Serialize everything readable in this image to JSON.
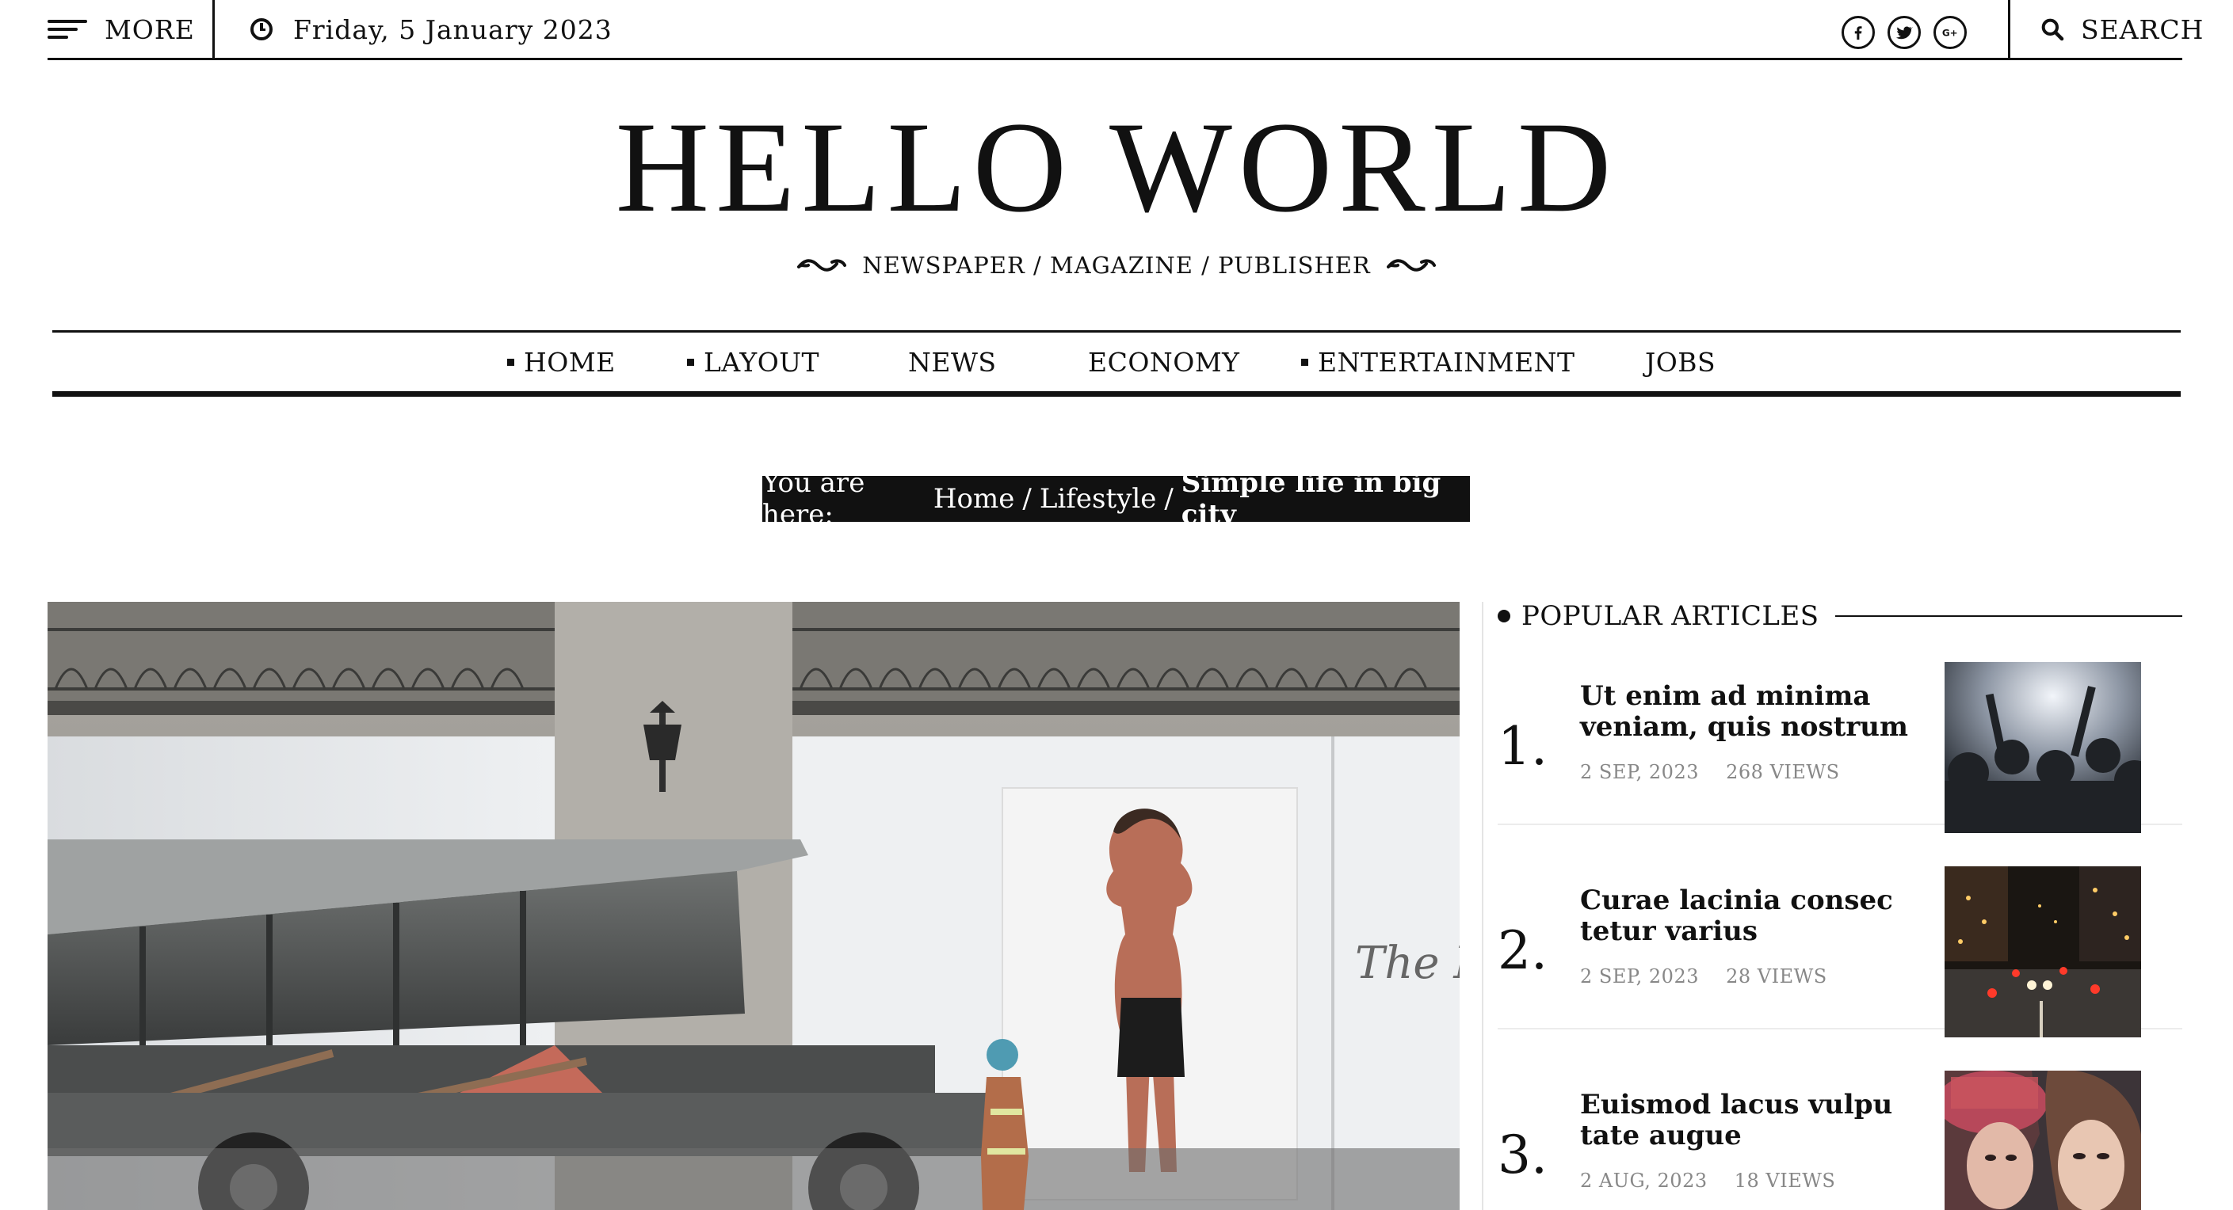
{
  "topbar": {
    "more_label": "MORE",
    "date": "Friday, 5 January 2023",
    "search_label": "SEARCH",
    "social_icons": [
      "facebook-icon",
      "twitter-icon",
      "google-plus-icon"
    ]
  },
  "masthead": {
    "title": "HELLO WORLD",
    "tagline": "NEWSPAPER / MAGAZINE / PUBLISHER"
  },
  "nav": {
    "items": [
      {
        "label": "HOME",
        "has_submenu": true
      },
      {
        "label": "LAYOUT",
        "has_submenu": true
      },
      {
        "label": "NEWS",
        "has_submenu": false
      },
      {
        "label": "ECONOMY",
        "has_submenu": false
      },
      {
        "label": "ENTERTAINMENT",
        "has_submenu": true
      },
      {
        "label": "JOBS",
        "has_submenu": false
      }
    ]
  },
  "breadcrumb": {
    "prefix": "You are here:",
    "home": "Home",
    "section": "Lifestyle",
    "current": "Simple life in big city",
    "separator": "/"
  },
  "sidebar": {
    "heading": "POPULAR ARTICLES",
    "articles": [
      {
        "rank": "1.",
        "title": "Ut enim ad minima veniam, quis nostrum",
        "date": "2 SEP, 2023",
        "views": "268 VIEWS"
      },
      {
        "rank": "2.",
        "title": "Curae lacinia consec tetur varius",
        "date": "2 SEP, 2023",
        "views": "28 VIEWS"
      },
      {
        "rank": "3.",
        "title": "Euismod lacus vulpu tate augue",
        "date": "2 AUG, 2023",
        "views": "18 VIEWS"
      }
    ]
  },
  "colors": {
    "text": "#111111",
    "meta": "#888888",
    "breadcrumb_bg": "#111111",
    "breadcrumb_text": "#ffffff"
  }
}
